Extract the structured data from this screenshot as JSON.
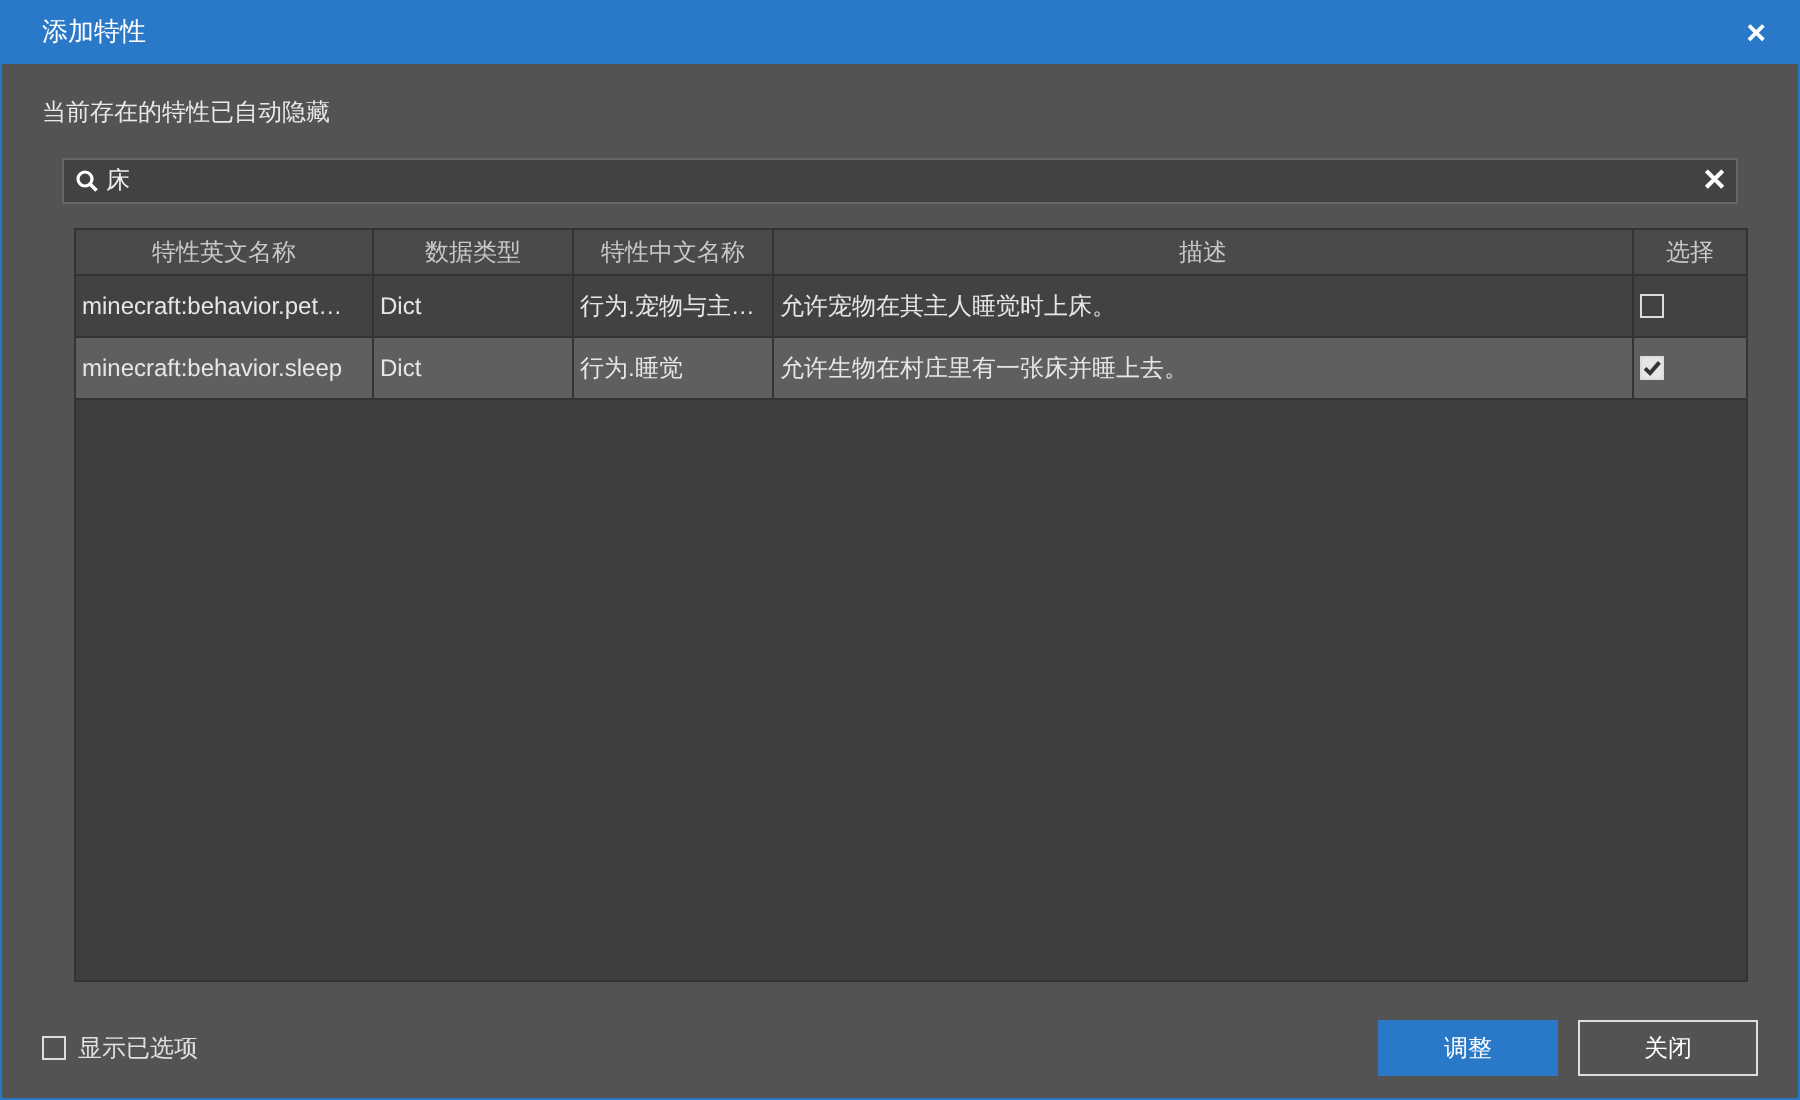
{
  "window": {
    "title": "添加特性",
    "close": "×"
  },
  "hint": "当前存在的特性已自动隐藏",
  "search": {
    "value": "床",
    "clear": "✕"
  },
  "table": {
    "columns": [
      "特性英文名称",
      "数据类型",
      "特性中文名称",
      "描述",
      "选择"
    ],
    "rows": [
      {
        "cells": [
          "minecraft:behavior.pet…",
          "Dict",
          "行为.宠物与主…",
          "允许宠物在其主人睡觉时上床。"
        ],
        "checked": false,
        "selected": false
      },
      {
        "cells": [
          "minecraft:behavior.sleep",
          "Dict",
          "行为.睡觉",
          "允许生物在村庄里有一张床并睡上去。"
        ],
        "checked": true,
        "selected": true
      }
    ]
  },
  "show_selected": {
    "label": "显示已选项",
    "checked": false
  },
  "buttons": [
    {
      "label": "调整",
      "kind": "primary"
    },
    {
      "label": "关闭",
      "kind": "secondary"
    }
  ]
}
